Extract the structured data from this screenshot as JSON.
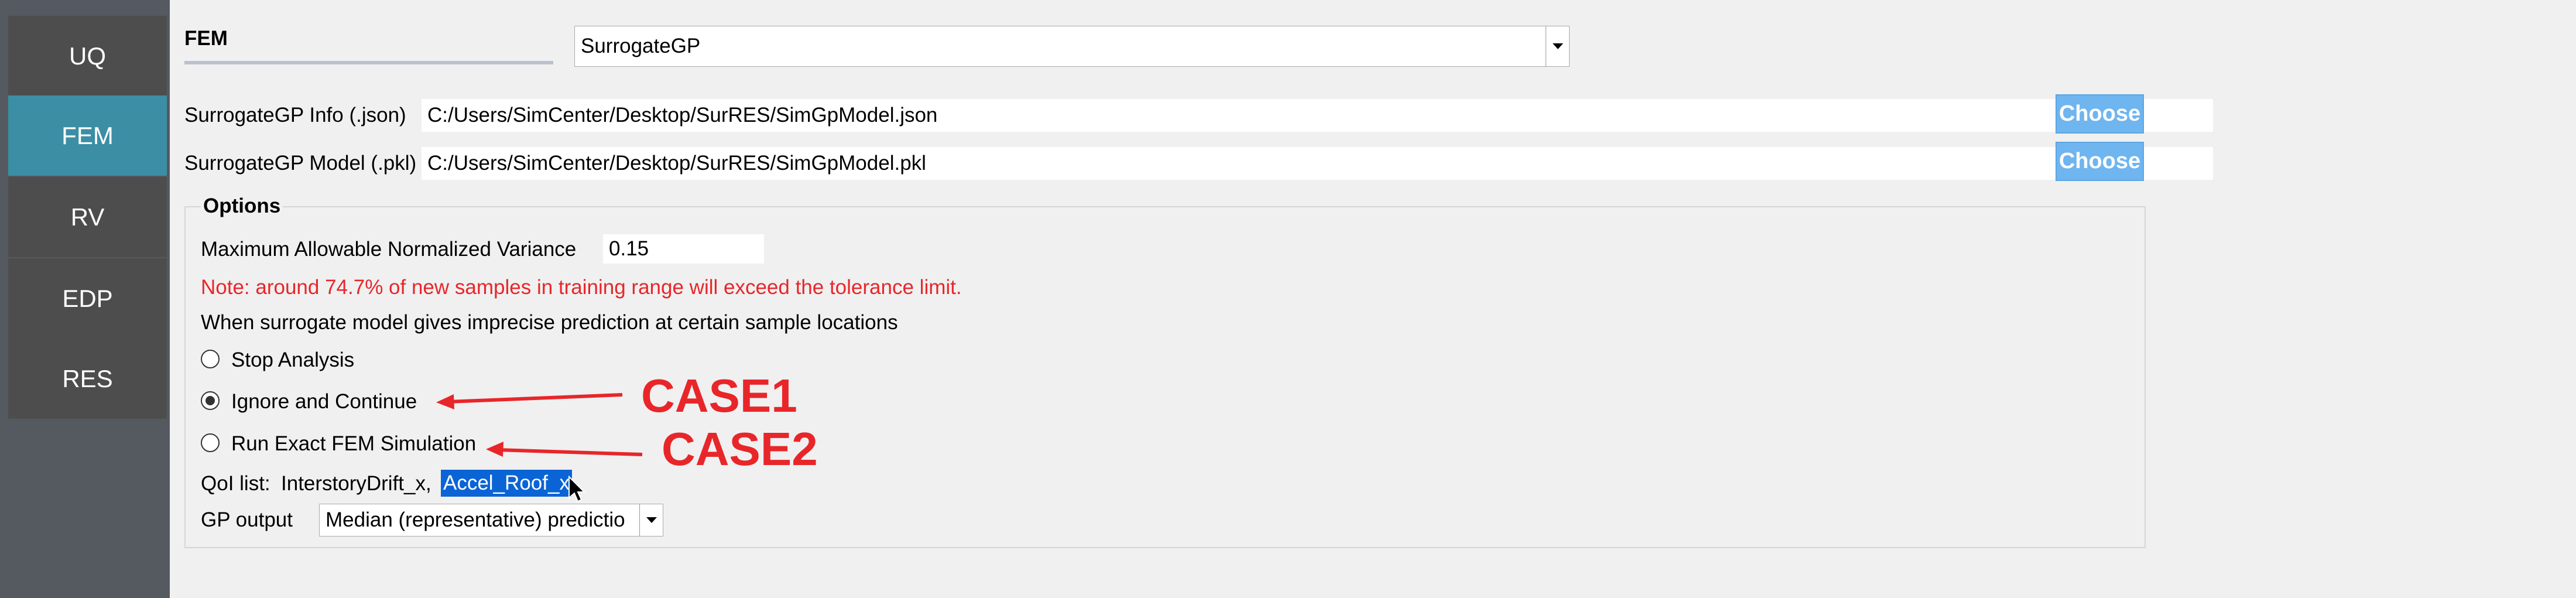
{
  "sidebar": {
    "items": [
      {
        "label": "UQ"
      },
      {
        "label": "FEM"
      },
      {
        "label": "RV"
      },
      {
        "label": "EDP"
      },
      {
        "label": "RES"
      }
    ],
    "active": "FEM"
  },
  "header": {
    "tab_label": "FEM",
    "application_select": "SurrogateGP"
  },
  "files": {
    "info_label": "SurrogateGP Info (.json)",
    "info_path": "C:/Users/SimCenter/Desktop/SurRES/SimGpModel.json",
    "model_label": "SurrogateGP Model (.pkl)",
    "model_path": "C:/Users/SimCenter/Desktop/SurRES/SimGpModel.pkl",
    "choose_label": "Choose"
  },
  "options": {
    "title": "Options",
    "variance_label": "Maximum Allowable Normalized Variance",
    "variance_value": "0.15",
    "note": "Note: around 74.7% of new samples in training range will exceed the tolerance limit.",
    "question": "When surrogate model gives imprecise prediction at certain sample locations",
    "radio_options": [
      {
        "label": "Stop Analysis",
        "selected": false
      },
      {
        "label": "Ignore and Continue",
        "selected": true
      },
      {
        "label": "Run Exact FEM Simulation",
        "selected": false
      }
    ],
    "qoi_prefix": "QoI list:",
    "qoi_item1": "InterstoryDrift_x,",
    "qoi_item2": "Accel_Roof_x",
    "gp_output_label": "GP output",
    "gp_output_value": "Median (representative) predictio"
  },
  "annotations": {
    "case1": "CASE1",
    "case2": "CASE2",
    "color": "#e8262a"
  },
  "colors": {
    "sidebar_bg": "#555a61",
    "nav_item_bg": "#4d4d4d",
    "nav_active_bg": "#3b8ea4",
    "button_bg": "#6fb5f0",
    "note_text": "#e8262a",
    "selection_bg": "#0a64d6"
  }
}
